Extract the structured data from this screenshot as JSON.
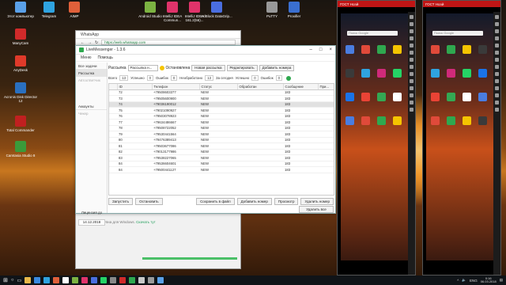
{
  "desktop": {
    "icons": [
      {
        "label": "Этот компьютер",
        "color": "#5aa0e8"
      },
      {
        "label": "Telegram",
        "color": "#2fa3e0"
      },
      {
        "label": "AIMP",
        "color": "#e0603a"
      },
      {
        "label": "Android Studio",
        "color": "#7cb342"
      },
      {
        "label": "IntelliJ IDEA Commun...",
        "color": "#e0336a"
      },
      {
        "label": "IntelliJ IDEA 161.2(56)...",
        "color": "#e0336a"
      },
      {
        "label": "AdBlock DataGrip...",
        "color": "#4a6ee0"
      },
      {
        "label": "PuTTY",
        "color": "#999999"
      },
      {
        "label": "Proxifier",
        "color": "#3a6fd0"
      },
      {
        "label": "ManyCam",
        "color": "#d02a2a"
      },
      {
        "label": "AnyDesk",
        "color": "#e03a2a"
      },
      {
        "label": "Acronis Disk Director 12",
        "color": "#2a70c0"
      },
      {
        "label": "Total Commander",
        "color": "#c02020"
      },
      {
        "label": "Camtasia Studio 8",
        "color": "#3a9a3a"
      },
      {
        "label": "Корзина",
        "color": "#9ab0c8"
      }
    ]
  },
  "whatsapp_window": {
    "title": "WhatsApp",
    "url": "https://web.whatsapp.com",
    "note": "WhatsApp доступна для Windows.",
    "note_link": "Скачать тут"
  },
  "app": {
    "title": "LiveMessenger - 1.3.6",
    "menu": [
      "Меню",
      "Помощь"
    ],
    "sidebar": {
      "items": [
        {
          "label": "Все задачи",
          "active": false
        },
        {
          "label": "Рассылка",
          "active": true
        },
        {
          "label": "Автоответчик",
          "active": false,
          "dim": true
        },
        {
          "label": "Аккаунты",
          "active": false
        },
        {
          "label": "Чекер",
          "active": false,
          "dim": true
        }
      ],
      "license_label": "Лицензия до",
      "license_date": "14.12.2018"
    },
    "toolbar": {
      "label": "Рассылка",
      "select": "Рассылка н...",
      "stop": "Остановлена",
      "new": "Новая рассылка",
      "edit": "Редактировать",
      "add_numbers": "Добавить номера"
    },
    "stats": {
      "total_label": "Всего",
      "total": "13",
      "success_label": "Успешно",
      "success": "0",
      "errors_label": "Ошибок",
      "errors": "0",
      "unprocessed_label": "Необработано",
      "unprocessed": "13",
      "today_label": "За сегодня",
      "sent_label": "Успешно",
      "sent": "0",
      "today_errors_label": "Ошибок",
      "today_errors": "0"
    },
    "table": {
      "columns": [
        "",
        "ID",
        "Телефон",
        "Статус",
        "Обработан",
        "Сообщение",
        "При..."
      ],
      "rows": [
        {
          "id": "72",
          "phone": "+79508603377",
          "status": "NEW",
          "processed": "",
          "msg": "183",
          "sel": false
        },
        {
          "id": "73",
          "phone": "+79505600900",
          "status": "NEW",
          "processed": "",
          "msg": "183",
          "sel": false
        },
        {
          "id": "74",
          "phone": "+79036190012",
          "status": "NEW",
          "processed": "",
          "msg": "183",
          "sel": true
        },
        {
          "id": "75",
          "phone": "+79021090927",
          "status": "NEW",
          "processed": "",
          "msg": "183",
          "sel": false
        },
        {
          "id": "76",
          "phone": "+79503078923",
          "status": "NEW",
          "processed": "",
          "msg": "183",
          "sel": false
        },
        {
          "id": "77",
          "phone": "+79634486667",
          "status": "NEW",
          "processed": "",
          "msg": "183",
          "sel": false
        },
        {
          "id": "78",
          "phone": "+79508722052",
          "status": "NEW",
          "processed": "",
          "msg": "183",
          "sel": false
        },
        {
          "id": "79",
          "phone": "+79530441564",
          "status": "NEW",
          "processed": "",
          "msg": "183",
          "sel": false
        },
        {
          "id": "80",
          "phone": "+79476389413",
          "status": "NEW",
          "processed": "",
          "msg": "183",
          "sel": false
        },
        {
          "id": "81",
          "phone": "+79503677086",
          "status": "NEW",
          "processed": "",
          "msg": "183",
          "sel": false
        },
        {
          "id": "82",
          "phone": "+79013177986",
          "status": "NEW",
          "processed": "",
          "msg": "183",
          "sel": false
        },
        {
          "id": "83",
          "phone": "+79538227065",
          "status": "NEW",
          "processed": "",
          "msg": "183",
          "sel": false
        },
        {
          "id": "84",
          "phone": "+79536604601",
          "status": "NEW",
          "processed": "",
          "msg": "183",
          "sel": false
        },
        {
          "id": "84",
          "phone": "+79500441127",
          "status": "NEW",
          "processed": "",
          "msg": "183",
          "sel": false
        }
      ]
    },
    "bottom": {
      "start": "Запустить",
      "stop": "Остановить",
      "save": "Сохранить в файл",
      "add": "Добавить номер",
      "view": "Просмотр",
      "delete_one": "Удалить номер",
      "delete_all": "Удалить все"
    }
  },
  "phones": [
    {
      "title": "ГОСТ Ноэй",
      "search": "Поиск Google"
    },
    {
      "title": "ГОСТ Ноэй",
      "search": "Поиск Google"
    }
  ],
  "taskbar": {
    "lang": "ENG",
    "time": "0:16",
    "date": "06.03.2018"
  }
}
